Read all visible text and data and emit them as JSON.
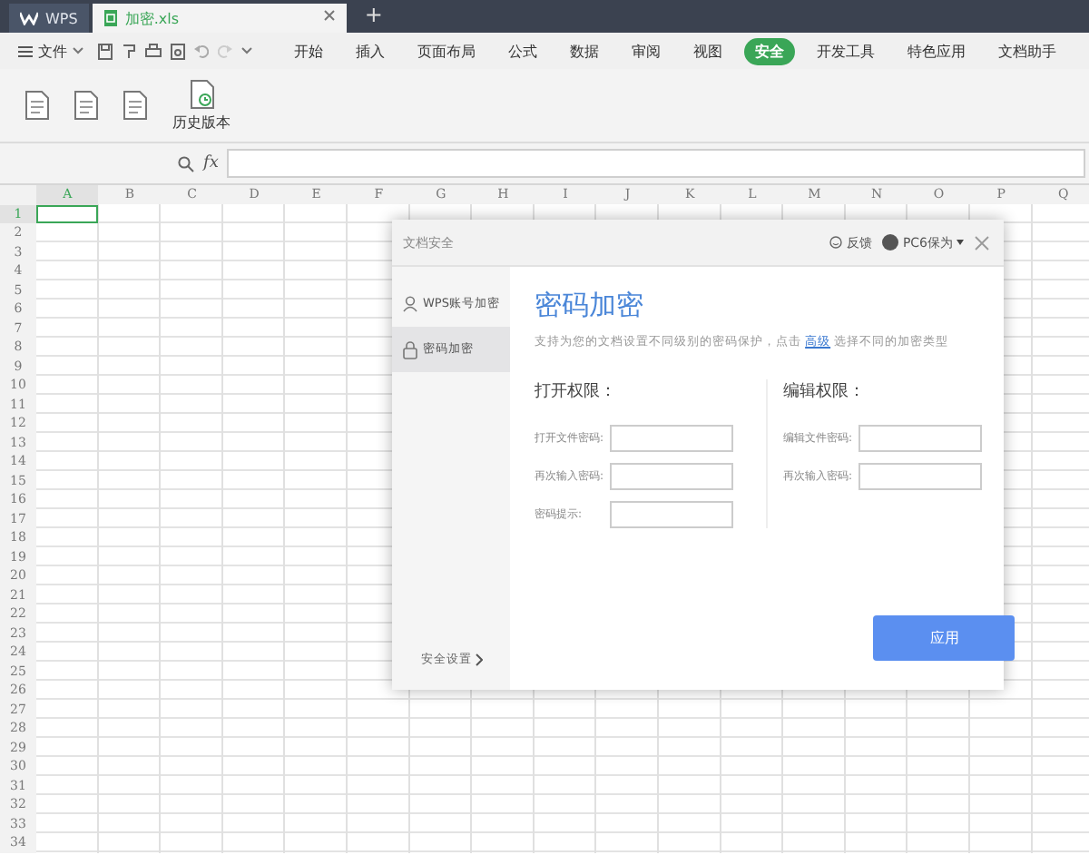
{
  "tabs": [
    {
      "label": "WPS",
      "selected": false
    },
    {
      "label": "加密.xls",
      "selected": true
    }
  ],
  "new_tab": "+",
  "menu": {
    "file": "文件",
    "items": [
      {
        "label": "开始",
        "selected": false
      },
      {
        "label": "插入",
        "selected": false
      },
      {
        "label": "页面布局",
        "selected": false
      },
      {
        "label": "公式",
        "selected": false
      },
      {
        "label": "数据",
        "selected": false
      },
      {
        "label": "审阅",
        "selected": false
      },
      {
        "label": "视图",
        "selected": false
      },
      {
        "label": "安全",
        "selected": true
      },
      {
        "label": "开发工具",
        "selected": false
      },
      {
        "label": "特色应用",
        "selected": false
      },
      {
        "label": "文档助手",
        "selected": false
      }
    ]
  },
  "ribbon": {
    "buttons": [
      {
        "kind": "icon"
      },
      {
        "kind": "icon"
      },
      {
        "kind": "icon"
      },
      {
        "kind": "labeled",
        "label": "历史版本"
      }
    ]
  },
  "formula_bar": {
    "fx": "fx"
  },
  "sheet": {
    "columns": [
      {
        "label": "A",
        "selected": true
      },
      {
        "label": "B",
        "selected": false
      },
      {
        "label": "C",
        "selected": false
      },
      {
        "label": "D",
        "selected": false
      },
      {
        "label": "E",
        "selected": false
      },
      {
        "label": "F",
        "selected": false
      },
      {
        "label": "G",
        "selected": false
      },
      {
        "label": "H",
        "selected": false
      },
      {
        "label": "I",
        "selected": false
      },
      {
        "label": "J",
        "selected": false
      },
      {
        "label": "K",
        "selected": false
      },
      {
        "label": "L",
        "selected": false
      },
      {
        "label": "M",
        "selected": false
      },
      {
        "label": "N",
        "selected": false
      },
      {
        "label": "O",
        "selected": false
      },
      {
        "label": "P",
        "selected": false
      },
      {
        "label": "Q",
        "selected": false
      }
    ],
    "rows": [
      {
        "label": "1",
        "selected": true
      },
      {
        "label": "2",
        "selected": false
      },
      {
        "label": "3",
        "selected": false
      },
      {
        "label": "4",
        "selected": false
      },
      {
        "label": "5",
        "selected": false
      },
      {
        "label": "6",
        "selected": false
      },
      {
        "label": "7",
        "selected": false
      },
      {
        "label": "8",
        "selected": false
      },
      {
        "label": "9",
        "selected": false
      },
      {
        "label": "10",
        "selected": false
      },
      {
        "label": "11",
        "selected": false
      },
      {
        "label": "12",
        "selected": false
      },
      {
        "label": "13",
        "selected": false
      },
      {
        "label": "14",
        "selected": false
      },
      {
        "label": "15",
        "selected": false
      },
      {
        "label": "16",
        "selected": false
      },
      {
        "label": "17",
        "selected": false
      },
      {
        "label": "18",
        "selected": false
      },
      {
        "label": "19",
        "selected": false
      },
      {
        "label": "20",
        "selected": false
      },
      {
        "label": "21",
        "selected": false
      },
      {
        "label": "22",
        "selected": false
      },
      {
        "label": "23",
        "selected": false
      },
      {
        "label": "24",
        "selected": false
      },
      {
        "label": "25",
        "selected": false
      },
      {
        "label": "26",
        "selected": false
      },
      {
        "label": "27",
        "selected": false
      },
      {
        "label": "28",
        "selected": false
      },
      {
        "label": "29",
        "selected": false
      },
      {
        "label": "30",
        "selected": false
      },
      {
        "label": "31",
        "selected": false
      },
      {
        "label": "32",
        "selected": false
      },
      {
        "label": "33",
        "selected": false
      },
      {
        "label": "34",
        "selected": false
      }
    ]
  },
  "dialog": {
    "title": "文档安全",
    "feedback": "反馈",
    "user": "PC6保为",
    "nav": [
      {
        "label": "WPS账号加密",
        "selected": false,
        "kind": "account"
      },
      {
        "label": "密码加密",
        "selected": true,
        "kind": "lock"
      }
    ],
    "settings_link": "安全设置",
    "heading": "密码加密",
    "description": "支持为您的文档设置不同级别的密码保护，点击 **高级** 选择不同的加密类型",
    "sections": [
      {
        "title": "打开权限：",
        "fields": [
          {
            "label": "打开文件密码:"
          },
          {
            "label": "再次输入密码:"
          },
          {
            "label": "密码提示:"
          }
        ]
      },
      {
        "title": "编辑权限：",
        "fields": [
          {
            "label": "编辑文件密码:"
          },
          {
            "label": "再次输入密码:"
          }
        ]
      }
    ],
    "apply": "应用"
  }
}
